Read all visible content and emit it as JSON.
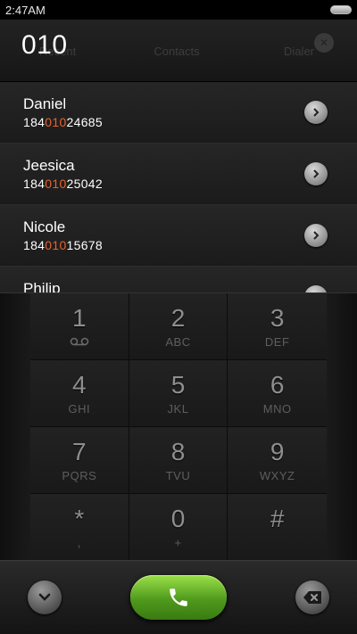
{
  "status": {
    "time": "2:47AM"
  },
  "header": {
    "dialed_number": "010",
    "tabs": [
      "Recent",
      "Contacts",
      "Dialer"
    ]
  },
  "contacts": [
    {
      "name": "Daniel",
      "num_pre": "184",
      "num_match": "010",
      "num_post": "24685"
    },
    {
      "name": "Jeesica",
      "num_pre": "184",
      "num_match": "010",
      "num_post": "25042"
    },
    {
      "name": "Nicole",
      "num_pre": "184",
      "num_match": "010",
      "num_post": "15678"
    },
    {
      "name": "Philip",
      "num_pre": "",
      "num_match": "",
      "num_post": ""
    }
  ],
  "keypad": [
    {
      "digit": "1",
      "letters": ""
    },
    {
      "digit": "2",
      "letters": "ABC"
    },
    {
      "digit": "3",
      "letters": "DEF"
    },
    {
      "digit": "4",
      "letters": "GHI"
    },
    {
      "digit": "5",
      "letters": "JKL"
    },
    {
      "digit": "6",
      "letters": "MNO"
    },
    {
      "digit": "7",
      "letters": "PQRS"
    },
    {
      "digit": "8",
      "letters": "TVU"
    },
    {
      "digit": "9",
      "letters": "WXYZ"
    },
    {
      "digit": "*",
      "letters": ","
    },
    {
      "digit": "0",
      "letters": "+"
    },
    {
      "digit": "#",
      "letters": ""
    }
  ],
  "colors": {
    "match_highlight": "#e8632a",
    "call_green": "#4f9a1c"
  },
  "icons": {
    "collapse": "chevron-down-icon",
    "call": "phone-icon",
    "delete": "backspace-icon",
    "voicemail": "voicemail-icon"
  }
}
